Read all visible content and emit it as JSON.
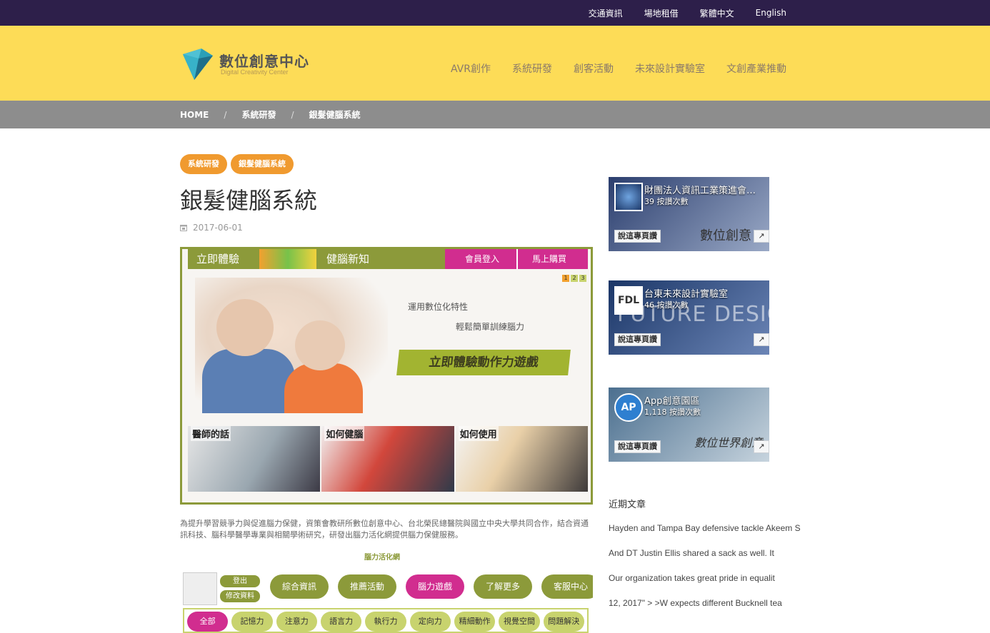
{
  "topbar": {
    "links": [
      "交通資訊",
      "場地租借",
      "繁體中文",
      "English"
    ]
  },
  "logo": {
    "name": "數位創意中心",
    "subtitle": "Digital Creativity Center"
  },
  "nav": {
    "items": [
      "AVR創作",
      "系統研發",
      "創客活動",
      "未來設計實驗室",
      "文創產業推動"
    ]
  },
  "breadcrumb": {
    "items": [
      "HOME",
      "系統研發",
      "銀髮健腦系統"
    ],
    "separator": "/"
  },
  "post": {
    "tags": [
      "系統研發",
      "銀髮健腦系統"
    ],
    "title": "銀髮健腦系統",
    "date": "2017-06-01",
    "hero": {
      "nav_items": [
        "立即體驗",
        "健腦新知",
        "會員登入",
        "馬上購買"
      ],
      "pager": [
        "1",
        "2",
        "3"
      ],
      "pager_active": 0,
      "tagline1": "運用數位化特性",
      "tagline2": "輕鬆簡單訓練腦力",
      "cta": "立即體驗動作力遊戲",
      "thumbs": [
        "醫師的話",
        "如何健腦",
        "如何使用"
      ]
    },
    "intro": "為提升學習競爭力與促進腦力保健，資策會教研所數位創意中心、台北榮民總醫院與國立中央大學共同合作，結合資通訊科技、腦科學醫學專業與相關學術研究，研發出腦力活化網提供腦力保健服務。",
    "game": {
      "brand": "腦力活化網",
      "account": [
        "登出",
        "修改資料"
      ],
      "menus": [
        "綜合資訊",
        "推薦活動",
        "腦力遊戲",
        "了解更多",
        "客服中心"
      ],
      "menu_active": 2,
      "filters": [
        "全部",
        "記憶力",
        "注意力",
        "語言力",
        "執行力",
        "定向力",
        "精細動作",
        "視覺空間",
        "問題解決"
      ],
      "filter_active": 0
    }
  },
  "sidebar": {
    "fb_pages": [
      {
        "name": "財團法人資訊工業策進會…",
        "likes": "39 按讚次數",
        "like_label": "說這專頁讚",
        "cover_text": "數位創意",
        "colors": [
          "#2b3e6e",
          "#9aa9c6"
        ]
      },
      {
        "name": "台東未來設計實驗室",
        "likes": "46 按讚次數",
        "like_label": "說這專頁讚",
        "cover_text": "FUTURE DESIGN L",
        "colors": [
          "#1b3667",
          "#6b85b6"
        ]
      },
      {
        "name": "App創意園區",
        "likes": "1,118 按讚次數",
        "like_label": "說這專頁讚",
        "cover_text": "數位世界創意",
        "colors": [
          "#4b6f8f",
          "#c7d4de"
        ]
      }
    ],
    "recent_title": "近期文章",
    "recent_posts": [
      "Hayden and Tampa Bay defensive tackle Akeem S",
      "And DT Justin Ellis shared a sack as well. It",
      "Our organization takes great pride in equalit",
      "12, 2017\" > >W expects different Bucknell tea"
    ]
  },
  "colors": {
    "topbar": "#2d1f4a",
    "header": "#fddc57",
    "crumbbar": "#8d8d8d",
    "tag": "#f09a2f",
    "olive": "#8c9a3a",
    "magenta": "#d12d8f"
  }
}
